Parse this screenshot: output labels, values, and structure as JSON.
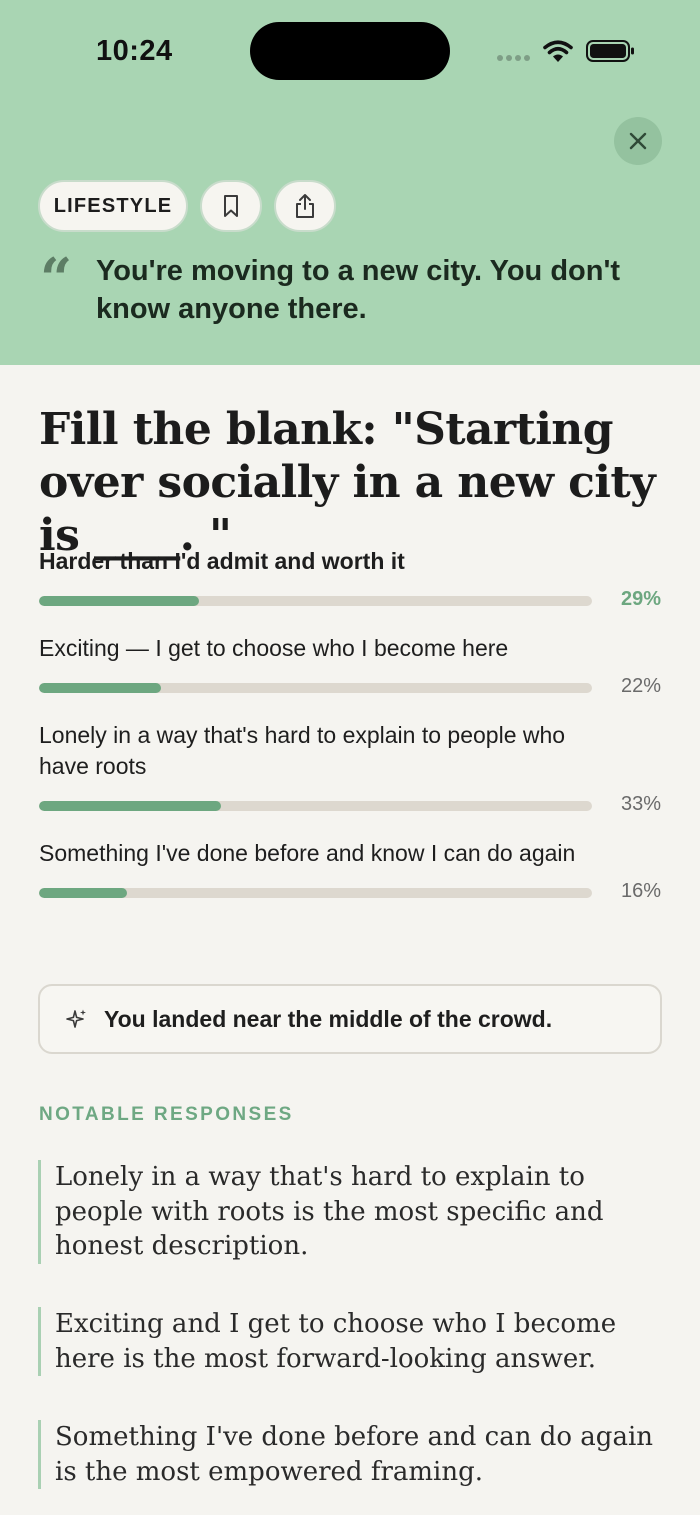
{
  "status_bar": {
    "time": "10:24"
  },
  "header": {
    "category": "LIFESTYLE",
    "scenario": "You're moving to a new city. You don't know anyone there."
  },
  "question": "Fill the blank: \"Starting over socially in a new city is ____. \"",
  "options": [
    {
      "label": "Harder than I'd admit and worth it",
      "percent": 29,
      "percent_label": "29%",
      "selected": true
    },
    {
      "label": "Exciting — I get to choose who I become here",
      "percent": 22,
      "percent_label": "22%",
      "selected": false
    },
    {
      "label": "Lonely in a way that's hard to explain to people who have roots",
      "percent": 33,
      "percent_label": "33%",
      "selected": false
    },
    {
      "label": "Something I've done before and know I can do again",
      "percent": 16,
      "percent_label": "16%",
      "selected": false
    }
  ],
  "insight": {
    "text": "You landed near the middle of the crowd."
  },
  "notable": {
    "title": "NOTABLE RESPONSES",
    "responses": [
      "Lonely in a way that's hard to explain to people with roots is the most specific and honest description.",
      "Exciting and I get to choose who I become here is the most forward-looking answer.",
      "Something I've done before and can do again is the most empowered framing."
    ]
  },
  "colors": {
    "header_bg": "#a9d5b3",
    "accent": "#6da780",
    "page_bg": "#f5f4f0"
  },
  "icons": {
    "close": "close-icon",
    "bookmark": "bookmark-icon",
    "share": "share-icon",
    "quote": "quote-icon",
    "sparkle": "sparkle-icon"
  }
}
